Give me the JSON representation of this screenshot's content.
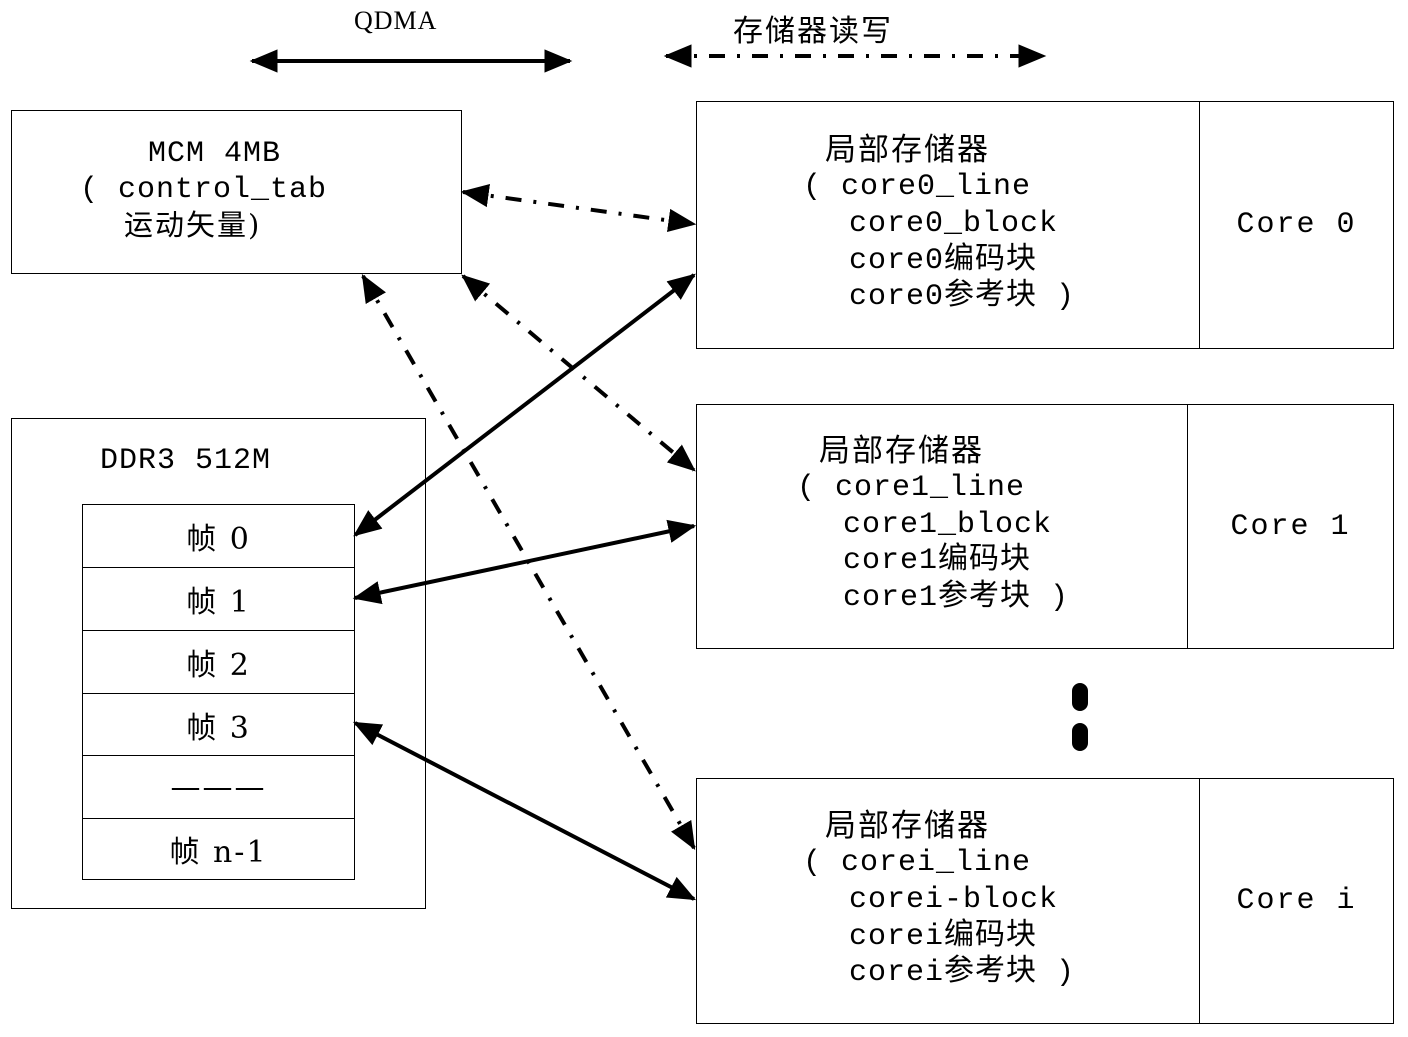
{
  "legend": {
    "qdma": {
      "label": "QDMA",
      "style": "solid-double-arrow"
    },
    "memory_rw": {
      "label": "存储器读写",
      "style": "dash-dot-double-arrow"
    }
  },
  "mcm": {
    "title": "MCM 4MB",
    "line2": "( control_tab",
    "line3": "运动矢量)"
  },
  "ddr3": {
    "title": "DDR3 512M",
    "frames": [
      "帧 0",
      "帧 1",
      "帧 2",
      "帧 3",
      "———",
      "帧 n-1"
    ]
  },
  "cores": [
    {
      "memory_title": "局部存储器",
      "lines": [
        "( core0_line",
        "core0_block",
        "core0编码块",
        "core0参考块 )"
      ],
      "core_label": "Core 0"
    },
    {
      "memory_title": "局部存储器",
      "lines": [
        "( core1_line",
        "core1_block",
        "core1编码块",
        "core1参考块 )"
      ],
      "core_label": "Core 1"
    },
    {
      "memory_title": "局部存储器",
      "lines": [
        "( corei_line",
        "corei-block",
        "corei编码块",
        "corei参考块 )"
      ],
      "core_label": "Core i"
    }
  ],
  "connections": [
    {
      "from": "mcm",
      "to": "core0-memory",
      "type": "memory_rw"
    },
    {
      "from": "mcm",
      "to": "core1-memory",
      "type": "memory_rw"
    },
    {
      "from": "mcm",
      "to": "corei-memory",
      "type": "memory_rw"
    },
    {
      "from": "ddr3-frame-0",
      "to": "core0-memory",
      "type": "qdma"
    },
    {
      "from": "ddr3-frame-1",
      "to": "core1-memory",
      "type": "qdma"
    },
    {
      "from": "ddr3-frame-3",
      "to": "corei-memory",
      "type": "qdma"
    }
  ],
  "ellipsis": "vertical-continuation"
}
